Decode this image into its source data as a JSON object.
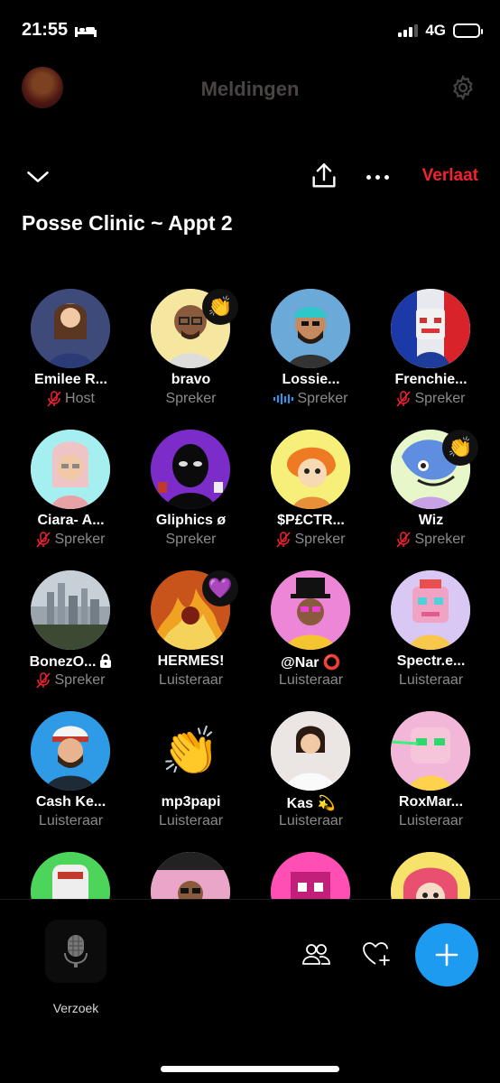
{
  "status": {
    "time": "21:55",
    "network": "4G",
    "battery_level": 0.62
  },
  "appbar": {
    "title": "Meldingen",
    "settings_icon": "gear-icon"
  },
  "space": {
    "title": "Posse Clinic ~ Appt 2",
    "leave_label": "Verlaat",
    "icons": [
      "chevron-down-icon",
      "share-icon",
      "more-icon"
    ]
  },
  "participants": [
    {
      "name": "Emilee R...",
      "role": "Host",
      "muted": true,
      "avatar": "woman-photo",
      "bg": "#3d4a7a"
    },
    {
      "name": "bravo",
      "role": "Spreker",
      "muted": false,
      "reaction": "👏",
      "avatar": "bald-man-glasses",
      "bg": "#f6e7a0"
    },
    {
      "name": "Lossie...",
      "role": "Spreker",
      "muted": false,
      "speaking": true,
      "avatar": "bearded-cap",
      "bg": "#6aa9d8"
    },
    {
      "name": "Frenchie...",
      "role": "Spreker",
      "muted": true,
      "avatar": "french-flag-robot",
      "bg": "#e8e8ef"
    },
    {
      "name": "Ciara- A...",
      "role": "Spreker",
      "muted": true,
      "avatar": "pink-hair-girl",
      "bg": "#a5eff0"
    },
    {
      "name": "Gliphics ø",
      "role": "Spreker",
      "muted": false,
      "avatar": "black-mask",
      "bg": "#7c2cc8"
    },
    {
      "name": "$P£CTR...",
      "role": "Spreker",
      "muted": true,
      "avatar": "orange-hair-cat",
      "bg": "#f6f07a"
    },
    {
      "name": "Wiz",
      "role": "Spreker",
      "muted": true,
      "reaction": "👏",
      "avatar": "blue-dragon",
      "bg": "#e8f7c9"
    },
    {
      "name": "BonezO...",
      "role": "Spreker",
      "muted": true,
      "locked": true,
      "avatar": "city-skyline",
      "bg": "#9aa4ad"
    },
    {
      "name": "HERMES!",
      "role": "Luisteraar",
      "muted": false,
      "reaction": "💜",
      "avatar": "fire-art",
      "bg": "#c8541c"
    },
    {
      "name": "@Nar ⭕",
      "role": "Luisteraar",
      "muted": false,
      "avatar": "top-hat-man",
      "bg": "#ee86d8"
    },
    {
      "name": "Spectr.e...",
      "role": "Luisteraar",
      "muted": false,
      "avatar": "pink-robot",
      "bg": "#d9c8f3"
    },
    {
      "name": "Cash Ke...",
      "role": "Luisteraar",
      "muted": false,
      "avatar": "cap-beard",
      "bg": "#2f9be6"
    },
    {
      "name": "mp3papi",
      "role": "Luisteraar",
      "muted": false,
      "avatar": "clapping-hands",
      "bg": "#000000"
    },
    {
      "name": "Kas 💫",
      "role": "Luisteraar",
      "muted": false,
      "avatar": "woman-selfie",
      "bg": "#ebe5e3"
    },
    {
      "name": "RoxMar...",
      "role": "Luisteraar",
      "muted": false,
      "avatar": "pink-laser-robot",
      "bg": "#f2b6d9"
    },
    {
      "name": "",
      "role": "",
      "avatar": "green-robot",
      "bg": "#4cd45b"
    },
    {
      "name": "",
      "role": "",
      "avatar": "stank-hammer",
      "bg": "#e9a6c9"
    },
    {
      "name": "",
      "role": "",
      "avatar": "pink-pixel",
      "bg": "#ff4fb4"
    },
    {
      "name": "",
      "role": "",
      "avatar": "harley-girl",
      "bg": "#f7e36b"
    }
  ],
  "bottom": {
    "request_label": "Verzoek",
    "request_icon": "microphone-icon",
    "people_icon": "people-icon",
    "heart_icon": "heart-plus-icon",
    "fab_icon": "plus-icon"
  },
  "colors": {
    "accent": "#1d9bf0",
    "danger": "#f4212e",
    "muted_text": "#8b8b8b"
  }
}
